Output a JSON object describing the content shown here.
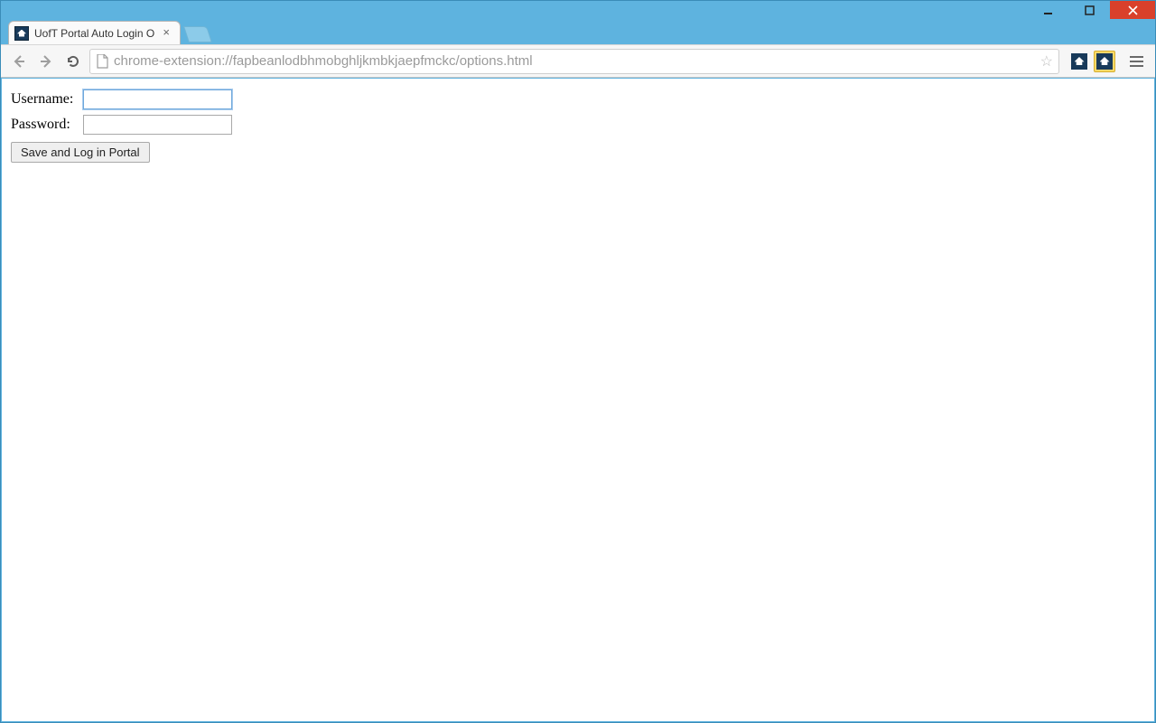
{
  "tab": {
    "title": "UofT Portal Auto Login O"
  },
  "address_bar": {
    "url": "chrome-extension://fapbeanlodbhmobghljkmbkjaepfmckc/options.html"
  },
  "form": {
    "username_label": "Username:",
    "username_value": "",
    "password_label": "Password:",
    "password_value": "",
    "submit_label": "Save and Log in Portal"
  }
}
